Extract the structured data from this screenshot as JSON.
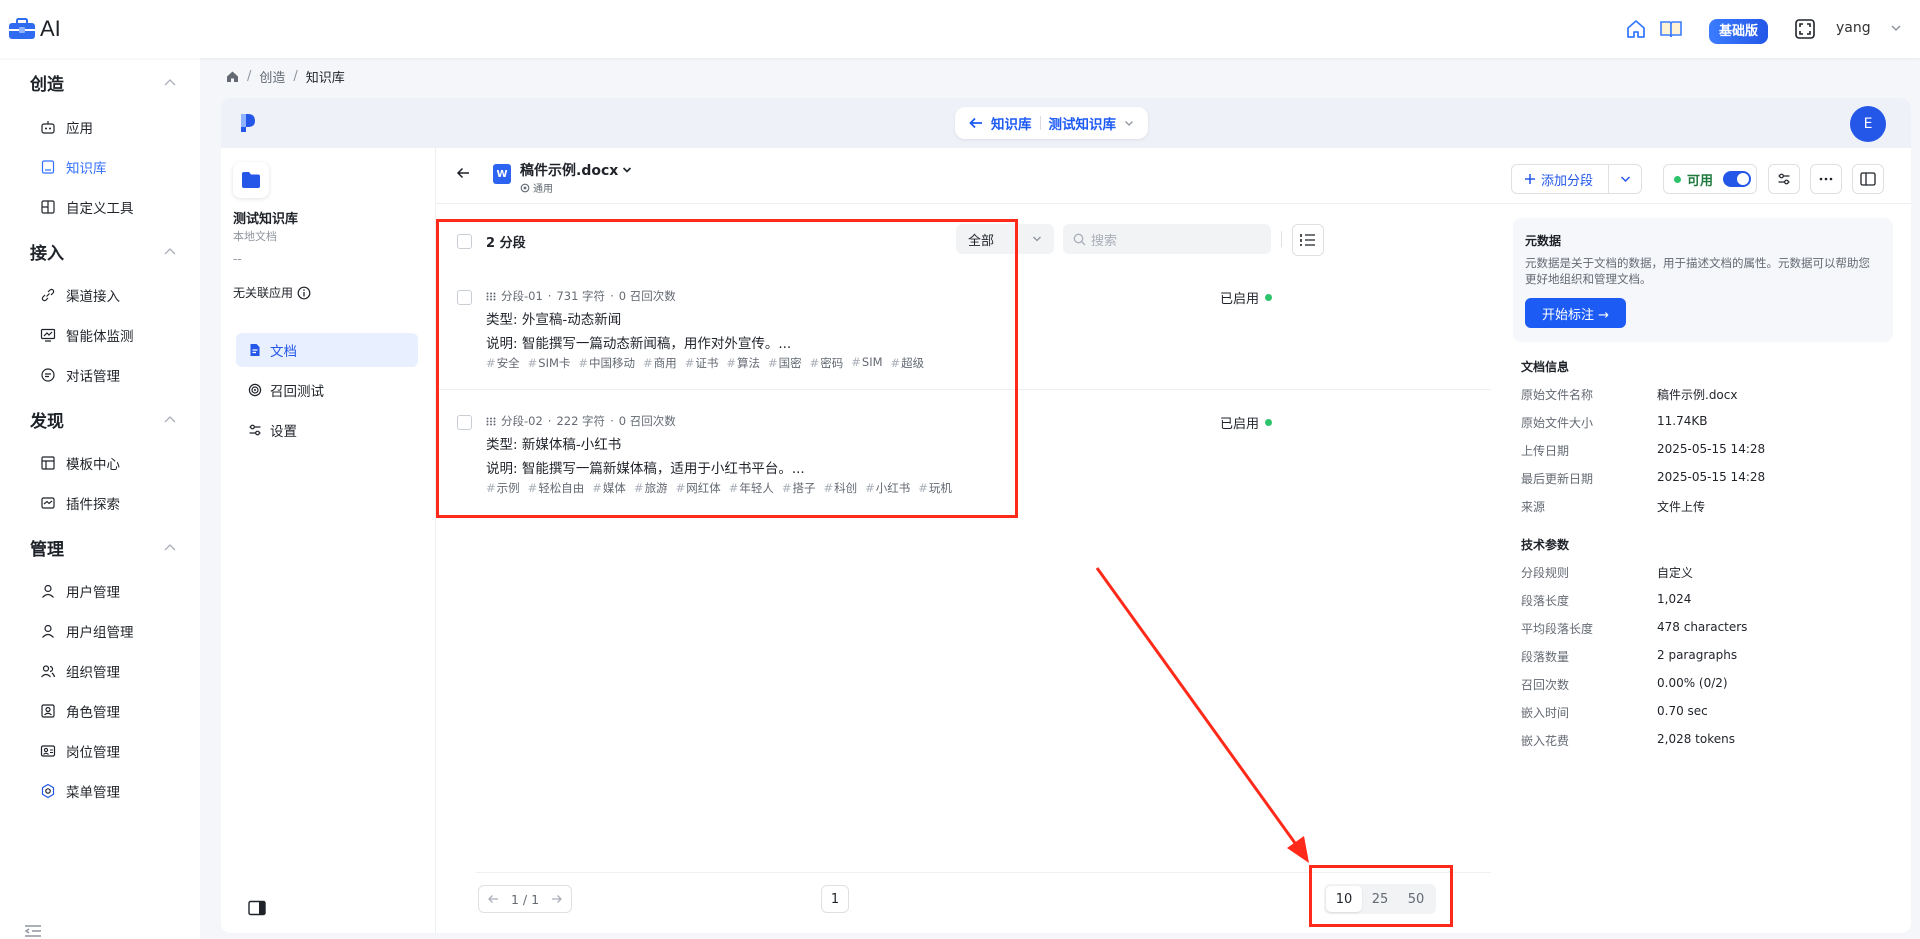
{
  "app": {
    "brand": "AI",
    "badge": "基础版",
    "user": "yang"
  },
  "colors": {
    "accent": "#2457e8",
    "annotation": "#ff2a1a",
    "enabled": "#2cc36b"
  },
  "nav": {
    "groups": [
      {
        "label": "创造",
        "items": [
          {
            "label": "应用",
            "icon": "robot-icon"
          },
          {
            "label": "知识库",
            "icon": "book-icon",
            "active": true
          },
          {
            "label": "自定义工具",
            "icon": "tool-icon"
          }
        ]
      },
      {
        "label": "接入",
        "items": [
          {
            "label": "渠道接入",
            "icon": "link-icon"
          },
          {
            "label": "智能体监测",
            "icon": "monitor-icon"
          },
          {
            "label": "对话管理",
            "icon": "chat-icon"
          }
        ]
      },
      {
        "label": "发现",
        "items": [
          {
            "label": "模板中心",
            "icon": "template-icon"
          },
          {
            "label": "插件探索",
            "icon": "plugin-icon"
          }
        ]
      },
      {
        "label": "管理",
        "items": [
          {
            "label": "用户管理",
            "icon": "user-icon"
          },
          {
            "label": "用户组管理",
            "icon": "user-icon"
          },
          {
            "label": "组织管理",
            "icon": "org-icon"
          },
          {
            "label": "角色管理",
            "icon": "role-icon"
          },
          {
            "label": "岗位管理",
            "icon": "post-icon"
          },
          {
            "label": "菜单管理",
            "icon": "menu-gear-icon"
          }
        ]
      }
    ]
  },
  "breadcrumb": {
    "sep": "/",
    "level1": "创造",
    "current": "知识库"
  },
  "header": {
    "kb_link": "知识库",
    "kb_current": "测试知识库",
    "avatar": "E"
  },
  "kb": {
    "name": "测试知识库",
    "type": "本地文档",
    "dash": "--",
    "no_app": "无关联应用",
    "tabs": [
      {
        "label": "文档",
        "active": true
      },
      {
        "label": "召回测试"
      },
      {
        "label": "设置"
      }
    ]
  },
  "doc": {
    "title": "稿件示例.docx",
    "mode": "通用",
    "add_segment": "添加分段",
    "available": "可用"
  },
  "list": {
    "count": "2 分段",
    "filter": "全部",
    "search_placeholder": "搜索",
    "segments": [
      {
        "id": "分段-01",
        "chars": "731 字符",
        "recalls": "0 召回次数",
        "line1": "类型: 外宣稿-动态新闻",
        "line2": "说明: 智能撰写一篇动态新闻稿，用作对外宣传。...",
        "tags": [
          "安全",
          "SIM卡",
          "中国移动",
          "商用",
          "证书",
          "算法",
          "国密",
          "密码",
          "SIM",
          "超级"
        ],
        "status": "已启用"
      },
      {
        "id": "分段-02",
        "chars": "222 字符",
        "recalls": "0 召回次数",
        "line1": "类型: 新媒体稿-小红书",
        "line2": "说明: 智能撰写一篇新媒体稿，适用于小红书平台。...",
        "tags": [
          "示例",
          "轻松自由",
          "媒体",
          "旅游",
          "网红体",
          "年轻人",
          "搭子",
          "科创",
          "小红书",
          "玩机"
        ],
        "status": "已启用"
      }
    ]
  },
  "pagination": {
    "range": "1 / 1",
    "page": "1",
    "sizes": [
      "10",
      "25",
      "50"
    ],
    "selected_size": "10"
  },
  "metadata": {
    "title": "元数据",
    "desc": "元数据是关于文档的数据，用于描述文档的属性。元数据可以帮助您更好地组织和管理文档。",
    "button": "开始标注 →"
  },
  "doc_info": {
    "title": "文档信息",
    "rows": [
      {
        "k": "原始文件名称",
        "v": "稿件示例.docx"
      },
      {
        "k": "原始文件大小",
        "v": "11.74KB"
      },
      {
        "k": "上传日期",
        "v": "2025-05-15 14:28"
      },
      {
        "k": "最后更新日期",
        "v": "2025-05-15 14:28"
      },
      {
        "k": "来源",
        "v": "文件上传"
      }
    ]
  },
  "tech": {
    "title": "技术参数",
    "rows": [
      {
        "k": "分段规则",
        "v": "自定义"
      },
      {
        "k": "段落长度",
        "v": "1,024"
      },
      {
        "k": "平均段落长度",
        "v": "478 characters"
      },
      {
        "k": "段落数量",
        "v": "2 paragraphs"
      },
      {
        "k": "召回次数",
        "v": "0.00% (0/2)"
      },
      {
        "k": "嵌入时间",
        "v": "0.70 sec"
      },
      {
        "k": "嵌入花费",
        "v": "2,028 tokens"
      }
    ]
  }
}
